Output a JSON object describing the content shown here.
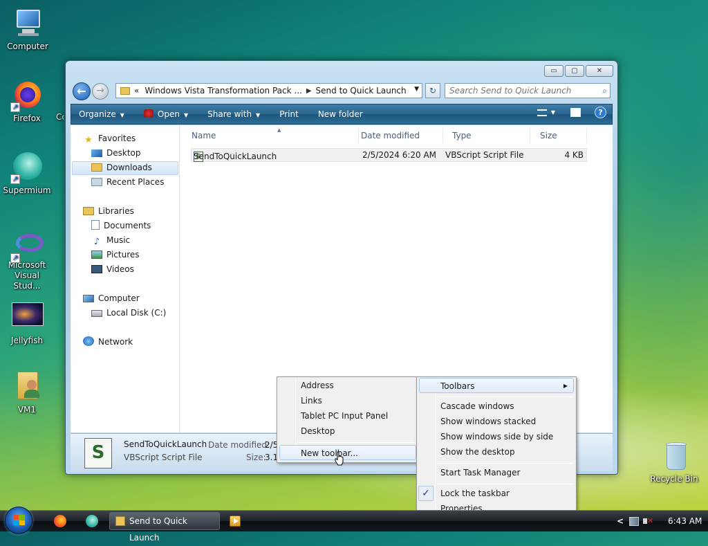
{
  "desktop": {
    "icons": [
      {
        "label": "Computer",
        "icon": "computer-icon"
      },
      {
        "label": "Firefox",
        "icon": "firefox-icon"
      },
      {
        "label": "Co",
        "icon": "partial-shortcut-icon"
      },
      {
        "label": "Supermium",
        "icon": "supermium-icon"
      },
      {
        "label": "Microsoft Visual Stud...",
        "icon": "visual-studio-icon"
      },
      {
        "label": "Jellyfish",
        "icon": "jellyfish-image-icon"
      },
      {
        "label": "VM1",
        "icon": "user-folder-icon"
      },
      {
        "label": "Recycle Bin",
        "icon": "recycle-bin-icon"
      }
    ]
  },
  "window": {
    "controls": {
      "minimize": "▭",
      "maximize": "▢",
      "close": "✕"
    },
    "nav": {
      "back": "←",
      "forward": "→"
    },
    "address": {
      "chevron": "«",
      "crumbs": [
        "Windows Vista Transformation Pack ...",
        "Send to Quick Launch"
      ],
      "separator": "▶",
      "dropdown": "▼"
    },
    "refresh": "↻",
    "search": {
      "placeholder": "Search Send to Quick Launch",
      "icon": "⌕"
    },
    "toolbar": {
      "organize": "Organize",
      "open": "Open",
      "share": "Share with",
      "print": "Print",
      "new_folder": "New folder",
      "dropdown_arrow": "▼",
      "help": "?"
    },
    "nav_pane": {
      "favorites": {
        "label": "Favorites",
        "items": [
          "Desktop",
          "Downloads",
          "Recent Places"
        ]
      },
      "libraries": {
        "label": "Libraries",
        "items": [
          "Documents",
          "Music",
          "Pictures",
          "Videos"
        ]
      },
      "computer": {
        "label": "Computer",
        "items": [
          "Local Disk (C:)"
        ]
      },
      "network": {
        "label": "Network"
      }
    },
    "columns": [
      "Name",
      "Date modified",
      "Type",
      "Size"
    ],
    "sort_indicator": "▲",
    "files": [
      {
        "name": "SendToQuickLaunch",
        "date": "2/5/2024 6:20 AM",
        "type": "VBScript Script File",
        "size": "4 KB"
      }
    ],
    "details": {
      "name": "SendToQuickLaunch",
      "type": "VBScript Script File",
      "date_label": "Date modified:",
      "date_value": "2/5",
      "size_label": "Size:",
      "size_value": "3.1"
    }
  },
  "toolbars_submenu": {
    "items": [
      "Address",
      "Links",
      "Tablet PC Input Panel",
      "Desktop"
    ],
    "new_toolbar": "New toolbar..."
  },
  "taskbar_menu": {
    "toolbars": "Toolbars",
    "submenu_arrow": "▶",
    "window_items": [
      "Cascade windows",
      "Show windows stacked",
      "Show windows side by side",
      "Show the desktop"
    ],
    "task_manager": "Start Task Manager",
    "lock": "Lock the taskbar",
    "lock_checked": "✓",
    "properties": "Properties"
  },
  "taskbar": {
    "task": "Send to Quick Launch",
    "tray_arrow": "<",
    "time": "6:43 AM"
  },
  "colors": {
    "accent": "#2b6690",
    "selection": "#d5e6f7"
  }
}
